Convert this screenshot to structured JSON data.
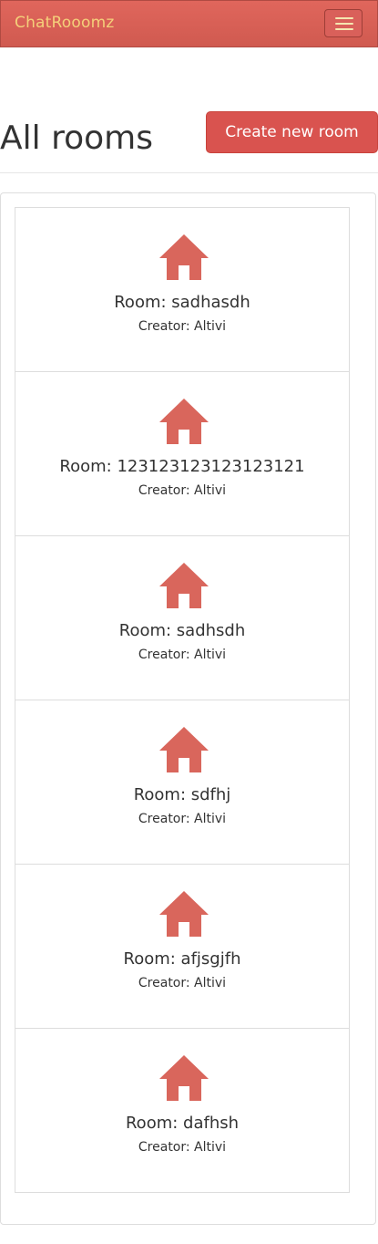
{
  "navbar": {
    "brand": "ChatRooomz",
    "brand_color": "#f4d07a",
    "background_color": "#d9605a",
    "menu_icon": "hamburger-menu-icon"
  },
  "header": {
    "title": "All rooms",
    "create_button_label": "Create new room",
    "accent_color": "#d9534f"
  },
  "rooms": [
    {
      "name": "Room: sadhasdh",
      "creator": "Creator: Altivi",
      "icon": "house-icon"
    },
    {
      "name": "Room: 123123123123123121",
      "creator": "Creator: Altivi",
      "icon": "house-icon"
    },
    {
      "name": "Room: sadhsdh",
      "creator": "Creator: Altivi",
      "icon": "house-icon"
    },
    {
      "name": "Room: sdfhj",
      "creator": "Creator: Altivi",
      "icon": "house-icon"
    },
    {
      "name": "Room: afjsgjfh",
      "creator": "Creator: Altivi",
      "icon": "house-icon"
    },
    {
      "name": "Room: dafhsh",
      "creator": "Creator: Altivi",
      "icon": "house-icon"
    }
  ]
}
